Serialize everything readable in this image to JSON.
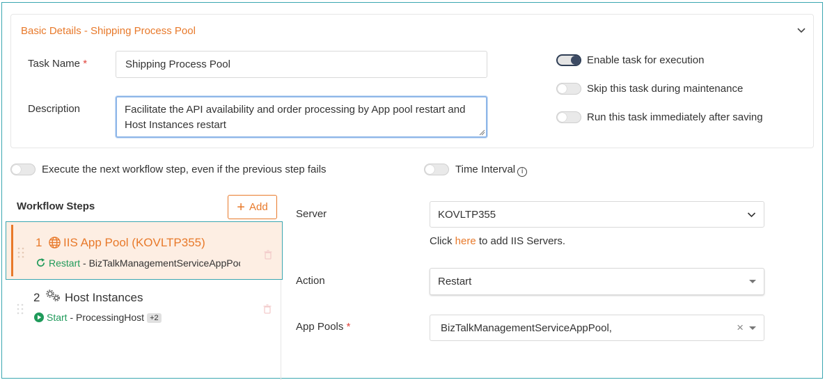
{
  "basic": {
    "title": "Basic Details - Shipping Process Pool",
    "task_name_label": "Task Name",
    "required_mark": "*",
    "task_name_value": "Shipping Process Pool",
    "description_label": "Description",
    "description_value": "Facilitate the API availability and order processing by App pool restart and Host Instances restart"
  },
  "toggles": {
    "enable_task": {
      "label": "Enable task for execution",
      "on": true
    },
    "skip_maintenance": {
      "label": "Skip this task during maintenance",
      "on": false
    },
    "run_immediately": {
      "label": "Run this task immediately after saving",
      "on": false
    },
    "execute_next": {
      "label": "Execute the next workflow step, even if the previous step fails",
      "on": false
    },
    "time_interval": {
      "label": "Time Interval",
      "on": false,
      "info_glyph": "i"
    }
  },
  "workflow": {
    "title": "Workflow Steps",
    "add_label": "Add",
    "add_glyph": "+",
    "steps": [
      {
        "number": "1",
        "title": "IIS App Pool (KOVLTP355)",
        "action": "Restart",
        "separator": " - ",
        "target": "BizTalkManagementServiceAppPool",
        "icon": "globe-icon"
      },
      {
        "number": "2",
        "title": "Host Instances",
        "action": "Start",
        "separator": " - ",
        "target": "ProcessingHost",
        "badge": "+2",
        "icon": "gears-icon"
      }
    ]
  },
  "details": {
    "server_label": "Server",
    "server_value": "KOVLTP355",
    "hint_prefix": "Click ",
    "hint_link": "here",
    "hint_suffix": " to add IIS Servers.",
    "action_label": "Action",
    "action_value": "Restart",
    "app_pools_label": "App Pools",
    "app_pools_value": "BizTalkManagementServiceAppPool,",
    "clear_glyph": "×"
  },
  "colors": {
    "accent": "#e8792a",
    "success": "#1f9a5a",
    "focus_border": "#3aa6b0",
    "toggle_on": "#2f3e55"
  }
}
